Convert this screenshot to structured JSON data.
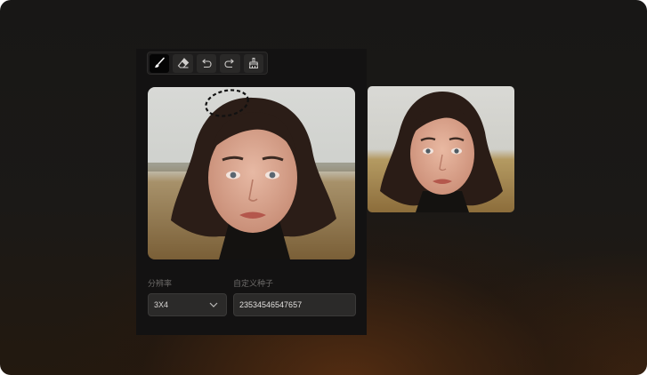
{
  "toolbar": {
    "tools": [
      {
        "name": "brush",
        "icon": "brush-icon",
        "active": true
      },
      {
        "name": "eraser",
        "icon": "eraser-icon",
        "active": false
      },
      {
        "name": "undo",
        "icon": "undo-icon",
        "active": false
      },
      {
        "name": "redo",
        "icon": "redo-icon",
        "active": false
      },
      {
        "name": "clear",
        "icon": "clear-icon",
        "active": false
      }
    ]
  },
  "form": {
    "resolution_label": "分辨率",
    "resolution_value": "3X4",
    "seed_label": "自定义种子",
    "seed_value": "23534546547657"
  },
  "colors": {
    "accent_background": "#131212",
    "input_background": "#2b2a29",
    "text": "#e2e0de"
  }
}
